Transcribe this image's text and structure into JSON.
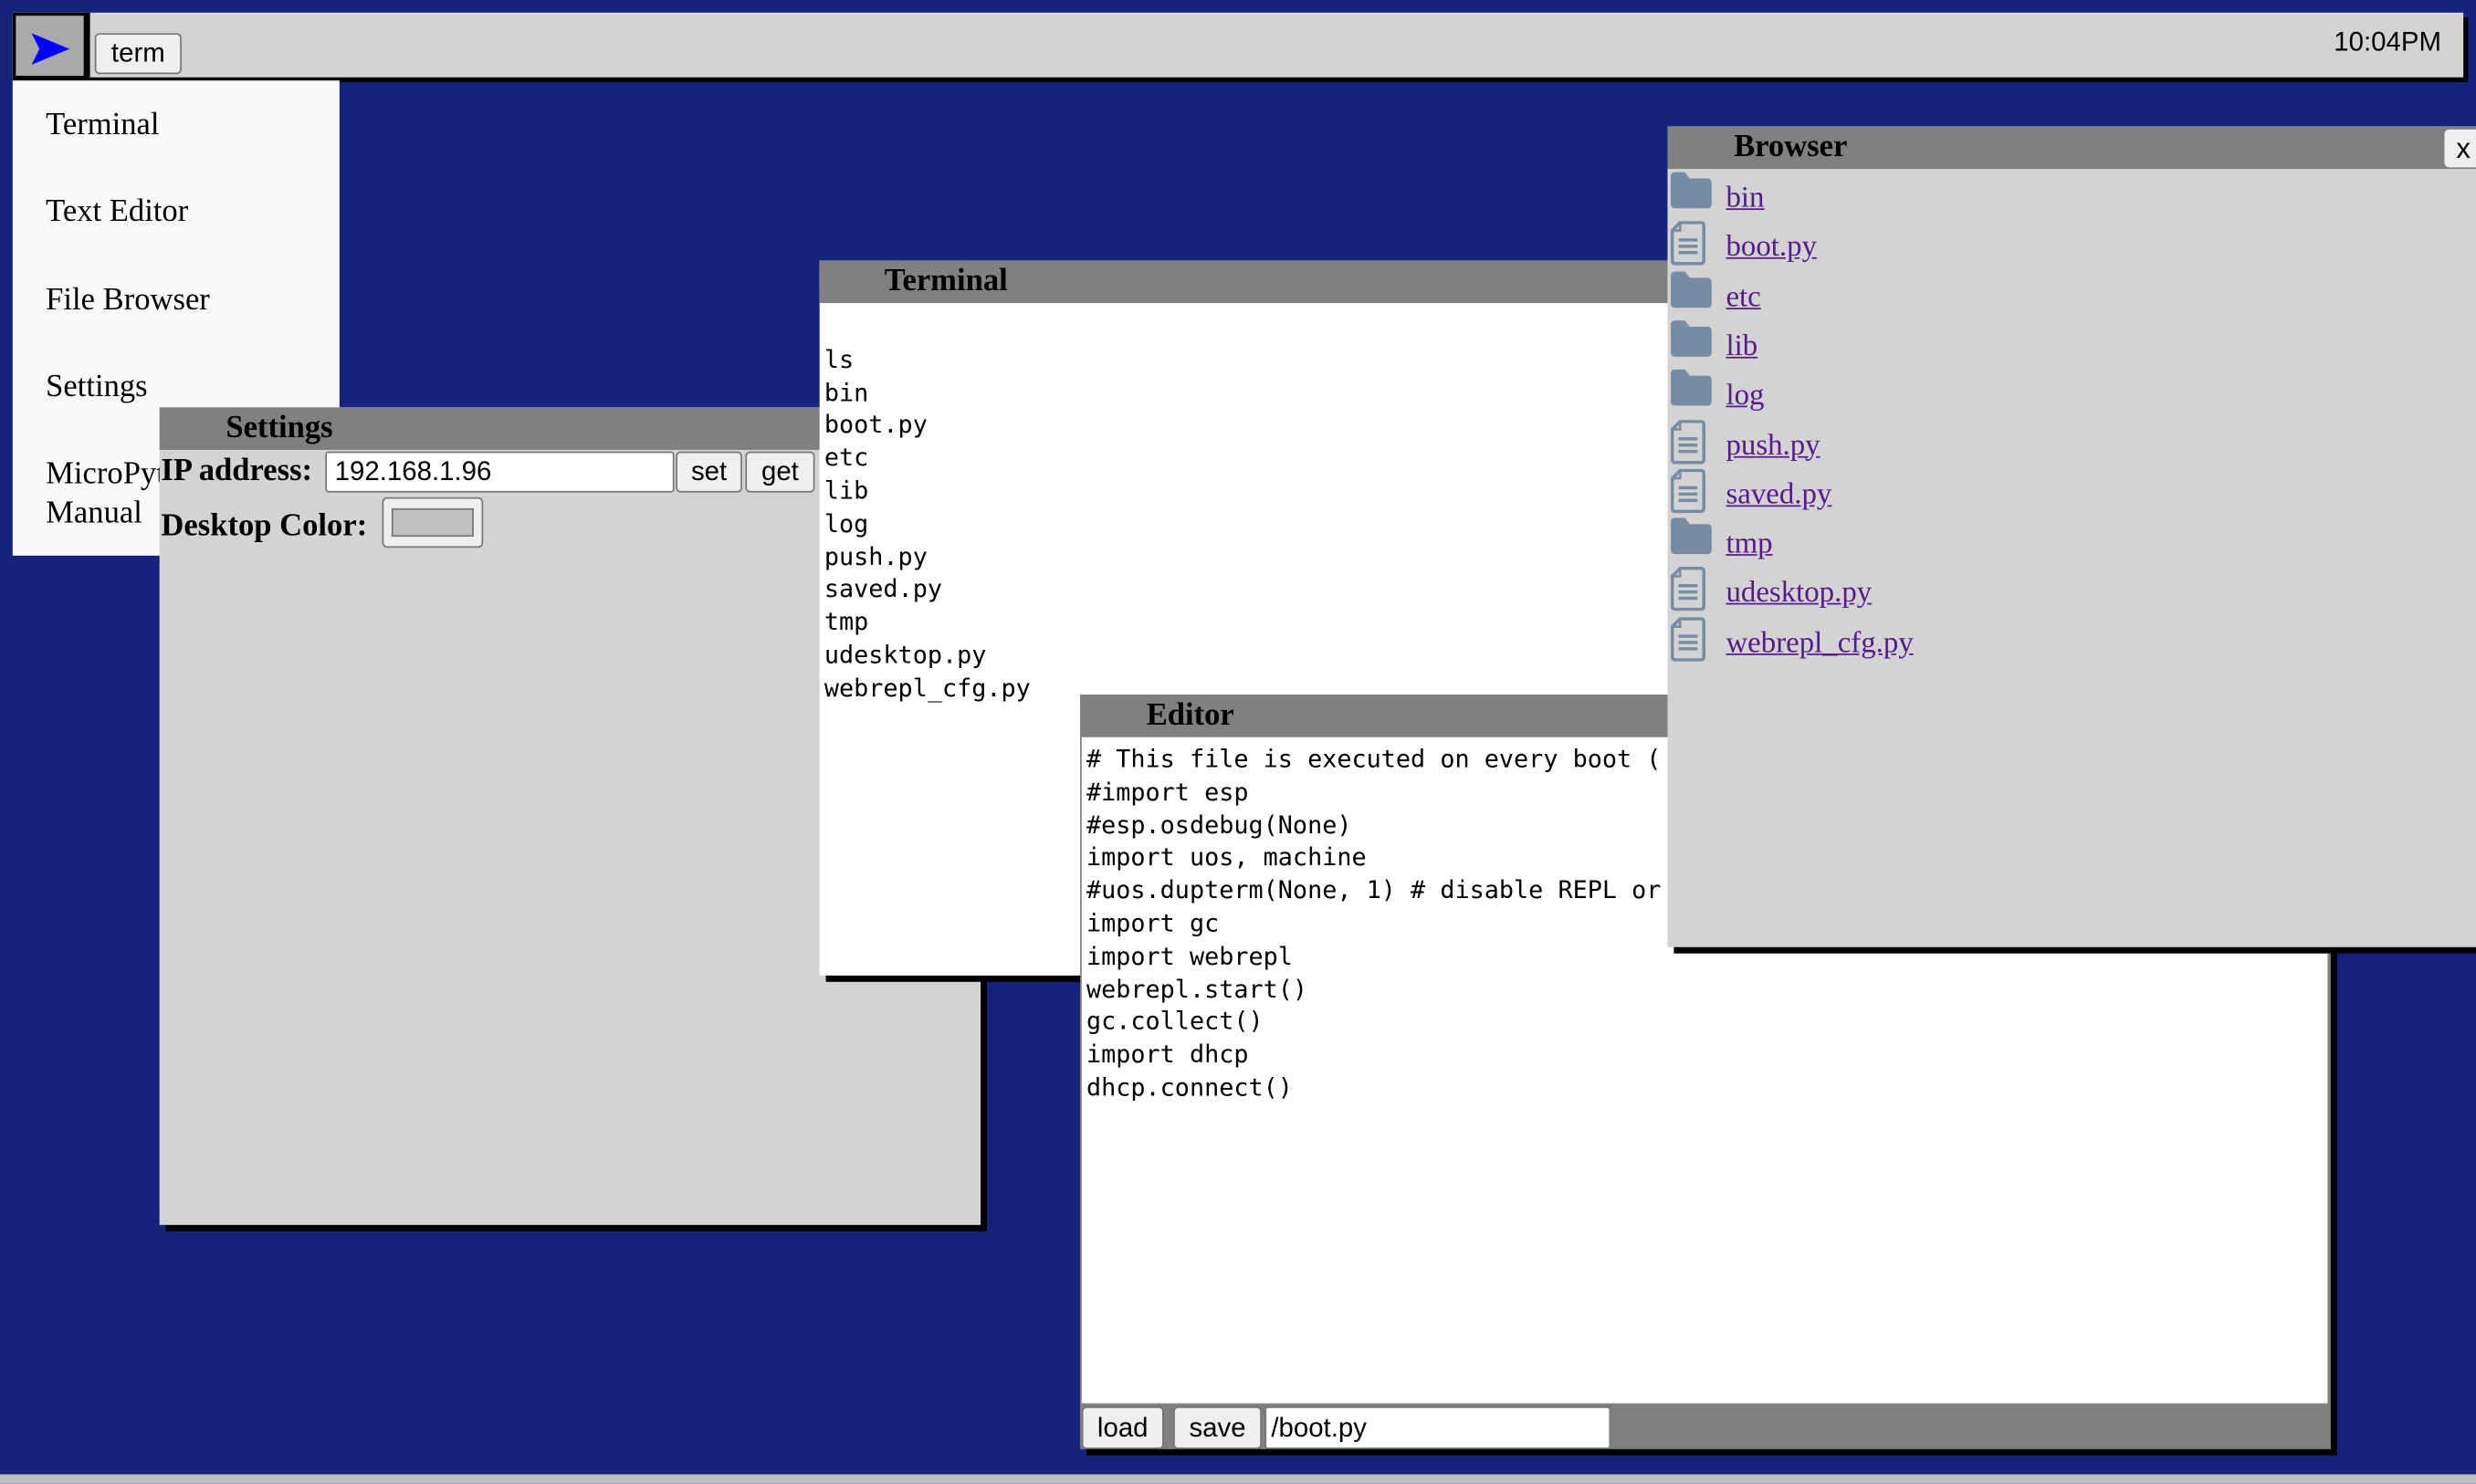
{
  "colors": {
    "desktop": "#15247a",
    "taskbar": "#d3d3d3",
    "titlebar": "#808080",
    "link": "#551a8b",
    "folder_icon": "#778ca3",
    "start_arrow": "#0000ff"
  },
  "taskbar": {
    "start_icon": "play-arrow-icon",
    "apps": [
      {
        "label": "term"
      }
    ],
    "clock": "10:04PM"
  },
  "menu": {
    "items": [
      {
        "label": "Terminal"
      },
      {
        "label": "Text Editor"
      },
      {
        "label": "File Browser"
      },
      {
        "label": "Settings"
      },
      {
        "label": "MicroPython Manual"
      }
    ]
  },
  "settings": {
    "title": "Settings",
    "ip_label": "IP address:",
    "ip_value": "192.168.1.96",
    "set_label": "set",
    "get_label": "get",
    "color_label": "Desktop Color:"
  },
  "terminal": {
    "title": "Terminal",
    "lines": [
      "",
      "ls",
      "bin",
      "boot.py",
      "etc",
      "lib",
      "log",
      "push.py",
      "saved.py",
      "tmp",
      "udesktop.py",
      "webrepl_cfg.py"
    ]
  },
  "editor": {
    "title": "Editor",
    "lines": [
      "# This file is executed on every boot (",
      "#import esp",
      "#esp.osdebug(None)",
      "import uos, machine",
      "#uos.dupterm(None, 1) # disable REPL or",
      "import gc",
      "import webrepl",
      "webrepl.start()",
      "gc.collect()",
      "import dhcp",
      "dhcp.connect()"
    ],
    "load_label": "load",
    "save_label": "save",
    "path_value": "/boot.py"
  },
  "browser": {
    "title": "Browser",
    "close_label": "x",
    "items": [
      {
        "name": "bin",
        "type": "folder"
      },
      {
        "name": "boot.py",
        "type": "file"
      },
      {
        "name": "etc",
        "type": "folder"
      },
      {
        "name": "lib",
        "type": "folder"
      },
      {
        "name": "log",
        "type": "folder"
      },
      {
        "name": "push.py",
        "type": "file"
      },
      {
        "name": "saved.py",
        "type": "file"
      },
      {
        "name": "tmp",
        "type": "folder"
      },
      {
        "name": "udesktop.py",
        "type": "file"
      },
      {
        "name": "webrepl_cfg.py",
        "type": "file"
      }
    ]
  }
}
